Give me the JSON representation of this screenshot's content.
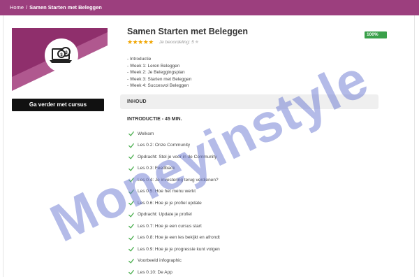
{
  "breadcrumb": {
    "home": "Home",
    "separator": "/",
    "current": "Samen Starten met Beleggen"
  },
  "course": {
    "title": "Samen Starten met Beleggen",
    "progress": "100%",
    "progress_percent": 100,
    "rating_stars": "★★★★★",
    "rating_label": "Je beoordeling: 5",
    "rating_star_icon": "★",
    "continue_label": "Ga verder met cursus",
    "outline": [
      "- Introductie",
      "- Week 1: Leren Beleggen",
      "- Week 2: Je Beleggingsplan",
      "- Week 3: Starten met Beleggen",
      "- Week 4: Succesvol Beleggen"
    ]
  },
  "contents": {
    "header": "INHOUD",
    "section_title": "INTRODUCTIE - 45 MIN.",
    "lessons": [
      "Welkom",
      "Les 0.2: Onze Community",
      "Opdracht: Stel je voor in de Community",
      "Les 0.3: Feedback",
      "Les 0.4: Je investering terug verdienen?",
      "Les 0.5: Hoe het menu werkt",
      "Les 0.6: Hoe je je profiel update",
      "Opdracht: Update je profiel",
      "Les 0.7: Hoe je een cursus start",
      "Les 0.8: Hoe je een les bekijkt en afrondt",
      "Les 0.9: Hoe je je progressie kunt volgen",
      "Voorbeeld infographic",
      "Les 0.10: De App"
    ]
  },
  "watermark": "Moneyinstyle",
  "colors": {
    "brand": "#9c3f7e",
    "success": "#3aa04a",
    "check": "#4caf50",
    "star": "#f0a500",
    "button": "#111111",
    "watermark": "#6978d2"
  },
  "icons": {
    "course_logo": "laptop-coins-icon",
    "lesson_status": "checkmark-icon",
    "rating": "star-icon"
  }
}
